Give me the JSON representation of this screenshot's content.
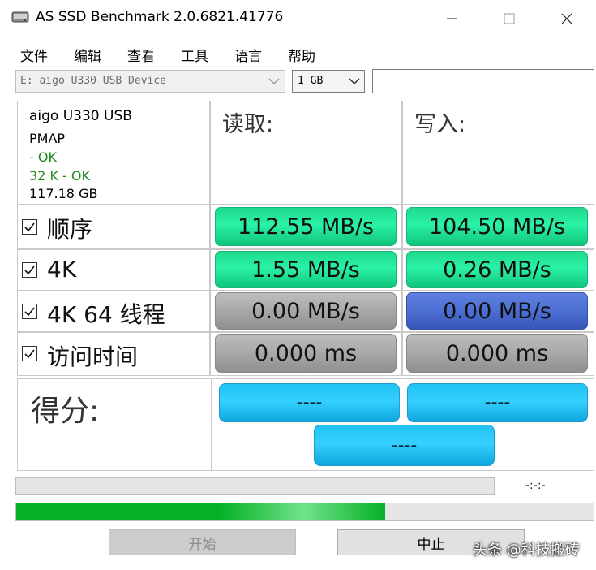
{
  "window": {
    "title": "AS SSD Benchmark 2.0.6821.41776",
    "icon": "hard-drive-icon"
  },
  "menu": [
    "文件",
    "编辑",
    "查看",
    "工具",
    "语言",
    "帮助"
  ],
  "toolbar": {
    "drive": "E: aigo U330 USB Device",
    "size": "1 GB",
    "text_value": ""
  },
  "info": {
    "device": "aigo U330 USB",
    "driver": "PMAP",
    "status1": " - OK",
    "status2": "32 K - OK",
    "capacity": "117.18 GB"
  },
  "headers": {
    "read": "读取:",
    "write": "写入:"
  },
  "tests": [
    {
      "label": "顺序",
      "checked": true,
      "read": "112.55 MB/s",
      "write": "104.50 MB/s"
    },
    {
      "label": "4K",
      "checked": true,
      "read": "1.55 MB/s",
      "write": "0.26 MB/s"
    },
    {
      "label": "4K 64 线程",
      "checked": true,
      "read": "0.00 MB/s",
      "write": "0.00 MB/s"
    },
    {
      "label": "访问时间",
      "checked": true,
      "read": "0.000 ms",
      "write": "0.000 ms"
    }
  ],
  "score": {
    "label": "得分:",
    "read": "----",
    "write": "----",
    "total": "----"
  },
  "progress": {
    "time": "-:-:-",
    "fraction": 0.639
  },
  "buttons": {
    "start": "开始",
    "stop": "中止"
  },
  "watermark": "头条 @科技搬砖",
  "colors": {
    "green_result": "#2af2a6",
    "blue_result": "#4d6fd3",
    "gray_result": "#a8a8a8",
    "score": "#35d0ff",
    "progress": "#06b025"
  }
}
